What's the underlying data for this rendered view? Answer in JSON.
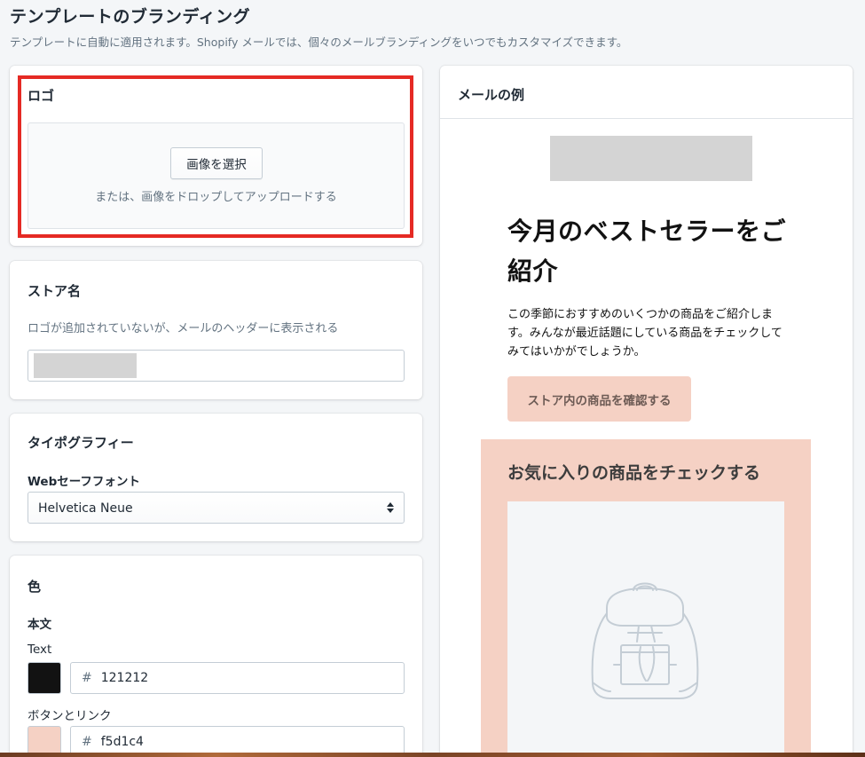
{
  "page": {
    "title": "テンプレートのブランディング",
    "subtitle": "テンプレートに自動に適用されます。Shopify メールでは、個々のメールブランディングをいつでもカスタマイズできます。"
  },
  "logo": {
    "heading": "ロゴ",
    "select_button": "画像を選択",
    "drop_hint": "または、画像をドロップしてアップロードする"
  },
  "store_name": {
    "heading": "ストア名",
    "help": "ロゴが追加されていないが、メールのヘッダーに表示される",
    "value": ""
  },
  "typography": {
    "heading": "タイポグラフィー",
    "font_label": "Webセーフフォント",
    "font_value": "Helvetica Neue"
  },
  "colors": {
    "heading": "色",
    "section": "本文",
    "text_label": "Text",
    "text_hex": "121212",
    "text_color": "#121212",
    "button_label": "ボタンとリンク",
    "button_hex": "f5d1c4",
    "button_color": "#f5d1c4",
    "hash": "#"
  },
  "preview": {
    "header": "メールの例",
    "headline": "今月のベストセラーをご紹介",
    "body": "この季節におすすめのいくつかの商品をご紹介します。みんなが最近話題にしている商品をチェックしてみてはいかがでしょうか。",
    "cta": "ストア内の商品を確認する",
    "featured_title": "お気に入りの商品をチェックする",
    "product_icon": "backpack-icon"
  },
  "theme": {
    "highlight": "#e52a24",
    "accent": "#f5d1c4"
  }
}
